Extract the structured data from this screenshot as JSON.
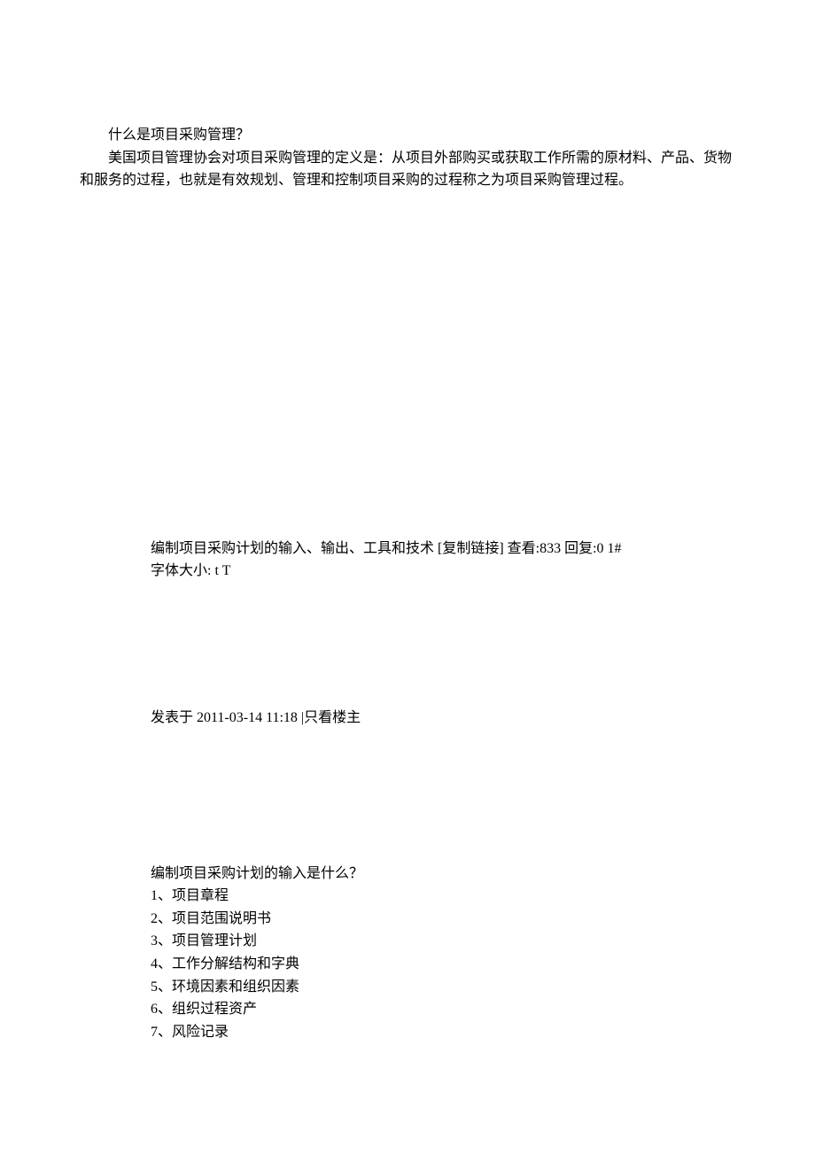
{
  "section1": {
    "title": "什么是项目采购管理？",
    "body": "美国项目管理协会对项目采购管理的定义是：从项目外部购买或获取工作所需的原材料、产品、货物和服务的过程，也就是有效规划、管理和控制项目采购的过程称之为项目采购管理过程。"
  },
  "section2": {
    "line1": "编制项目采购计划的输入、输出、工具和技术 [复制链接] 查看:833 回复:0    1#",
    "line2": "字体大小: t T"
  },
  "section3": {
    "postInfo": "发表于 2011-03-14 11:18 |只看楼主"
  },
  "section4": {
    "heading": "编制项目采购计划的输入是什么？",
    "items": [
      "1、项目章程",
      "2、项目范围说明书",
      "3、项目管理计划",
      "4、工作分解结构和字典",
      "5、环境因素和组织因素",
      "6、组织过程资产",
      "7、风险记录"
    ]
  }
}
